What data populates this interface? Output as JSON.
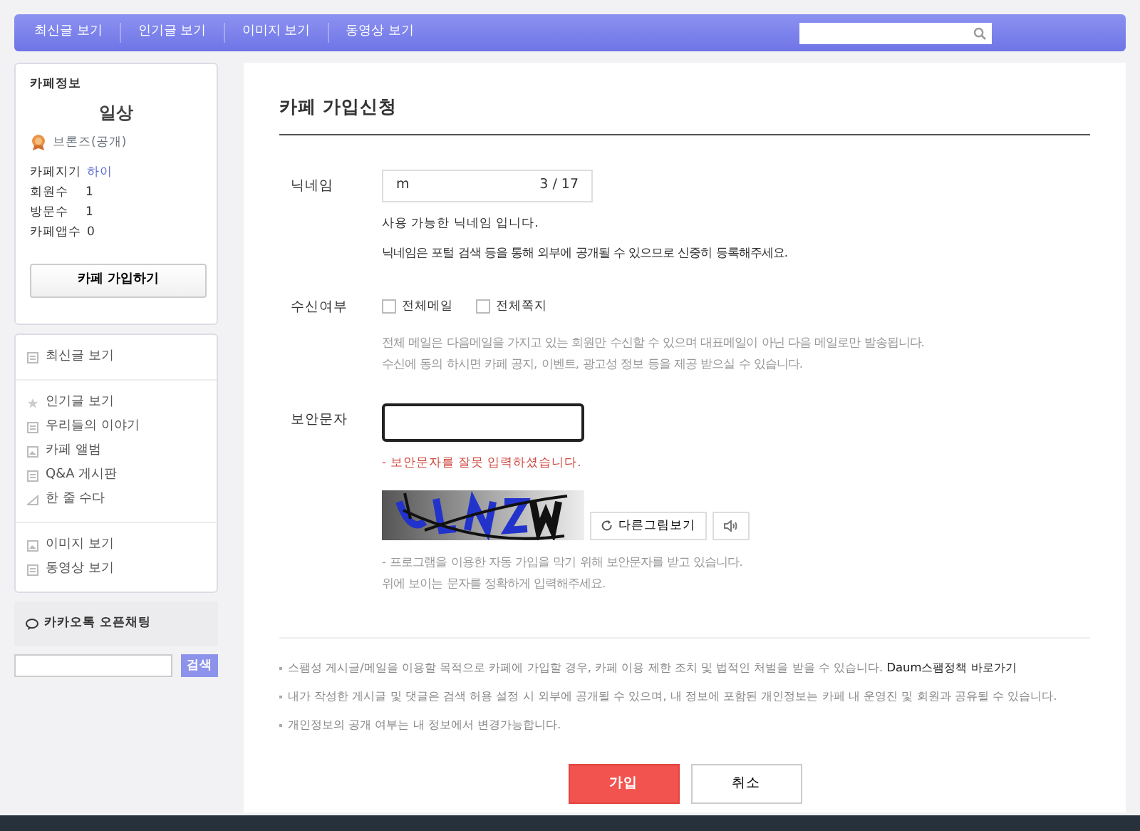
{
  "top_nav": {
    "items": [
      "최신글 보기",
      "인기글 보기",
      "이미지 보기",
      "동영상 보기"
    ]
  },
  "sidebar": {
    "cafe_info": {
      "heading": "카페정보",
      "name": "일상",
      "grade": "브론즈(공개)",
      "stats": [
        {
          "label": "카페지기",
          "value": "하이",
          "kind": "link"
        },
        {
          "label": "회원수",
          "value": "1",
          "kind": "plain"
        },
        {
          "label": "방문수",
          "value": "1",
          "kind": "plain"
        },
        {
          "label": "카페앱수",
          "value": "0",
          "kind": "plain"
        }
      ],
      "join_button": "카페 가입하기"
    },
    "menu_groups": [
      [
        {
          "label": "최신글 보기",
          "kind": "board"
        }
      ],
      [
        {
          "label": "인기글 보기",
          "kind": "star"
        },
        {
          "label": "우리들의 이야기",
          "kind": "board"
        },
        {
          "label": "카페 앨범",
          "kind": "album"
        },
        {
          "label": "Q&A 게시판",
          "kind": "board"
        },
        {
          "label": "한 줄 수다",
          "kind": "talk"
        }
      ],
      [
        {
          "label": "이미지 보기",
          "kind": "album"
        },
        {
          "label": "동영상 보기",
          "kind": "board"
        }
      ]
    ],
    "open_chat": "카카오톡 오픈채팅",
    "search_button": "검색"
  },
  "form": {
    "title": "카페 가입신청",
    "nickname": {
      "label": "닉네임",
      "value": "m",
      "counter": "3 / 17",
      "status": "사용 가능한 닉네임 입니다.",
      "note": "닉네임은 포털 검색 등을 통해 외부에 공개될 수 있으므로 신중히 등록해주세요."
    },
    "receive": {
      "label": "수신여부",
      "options": [
        {
          "label": "전체메일",
          "checked": false
        },
        {
          "label": "전체쪽지",
          "checked": false
        }
      ],
      "notes": [
        "전체 메일은 다음메일을 가지고 있는 회원만 수신할 수 있으며 대표메일이 아닌 다음 메일로만 발송됩니다.",
        "수신에 동의 하시면 카페 공지, 이벤트, 광고성 정보 등을 제공 받으실 수 있습니다."
      ]
    },
    "captcha": {
      "label": "보안문자",
      "error": "- 보안문자를 잘못 입력하셨습니다.",
      "image": {
        "kind": "picture"
      },
      "refresh_button": "다른그림보기",
      "notes": [
        "- 프로그램을 이용한 자동 가입을 막기 위해 보안문자를 받고 있습니다.",
        "위에 보이는 문자를 정확하게 입력해주세요."
      ]
    },
    "notices": [
      {
        "text": "스팸성 게시글/메일을 이용할 목적으로 카페에 가입할 경우, 카페 이용 제한 조치 및 법적인 처벌을 받을 수 있습니다.",
        "link": "Daum스팸정책 바로가기"
      },
      {
        "text": "내가 작성한 게시글 및 댓글은 검색 허용 설정 시 외부에 공개될 수 있으며, 내 정보에 포함된 개인정보는 카페 내 운영진 및 회원과 공유될 수 있습니다."
      },
      {
        "text": "개인정보의 공개 여부는 내 정보에서 변경가능합니다."
      }
    ],
    "buttons": {
      "submit": "가입",
      "cancel": "취소"
    }
  }
}
